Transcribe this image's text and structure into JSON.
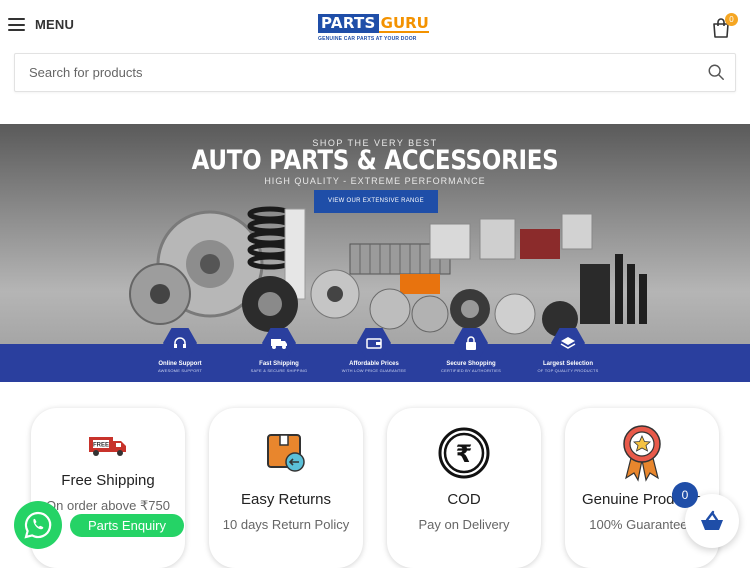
{
  "header": {
    "menu_label": "MENU",
    "logo": {
      "parts": "PARTS",
      "guru": "GURU",
      "tagline": "GENUINE CAR PARTS AT YOUR DOOR"
    },
    "cart_count": "0"
  },
  "search": {
    "placeholder": "Search for products"
  },
  "banner": {
    "kicker": "SHOP THE VERY BEST",
    "title": "AUTO PARTS & ACCESSORIES",
    "subtitle": "HIGH QUALITY - EXTREME PERFORMANCE",
    "cta": "VIEW OUR EXTENSIVE RANGE",
    "features": [
      {
        "title": "Online Support",
        "sub": "AWESOME SUPPORT",
        "icon": "headset-icon"
      },
      {
        "title": "Fast Shipping",
        "sub": "SAFE & SECURE SHIPPING",
        "icon": "truck-icon"
      },
      {
        "title": "Affordable Prices",
        "sub": "WITH LOW PRICE GUARANTEE",
        "icon": "wallet-icon"
      },
      {
        "title": "Secure Shopping",
        "sub": "CERTIFIED BY AUTHORITIES",
        "icon": "lock-icon"
      },
      {
        "title": "Largest Selection",
        "sub": "OF TOP QUALITY PRODUCTS",
        "icon": "layers-icon"
      }
    ]
  },
  "cards": [
    {
      "title": "Free Shipping",
      "sub": "On order above ₹750",
      "icon": "free-delivery-truck-icon"
    },
    {
      "title": "Easy Returns",
      "sub": "10 days Return Policy",
      "icon": "return-box-icon"
    },
    {
      "title": "COD",
      "sub": "Pay on Delivery",
      "icon": "rupee-icon"
    },
    {
      "title": "Genuine Products",
      "sub": "100% Guaranteed",
      "icon": "award-badge-icon"
    }
  ],
  "whatsapp": {
    "label": "Parts Enquiry"
  },
  "basket": {
    "count": "0"
  },
  "colors": {
    "brand_blue": "#1f4ea8",
    "brand_orange": "#f39200",
    "whatsapp_green": "#25d366"
  }
}
